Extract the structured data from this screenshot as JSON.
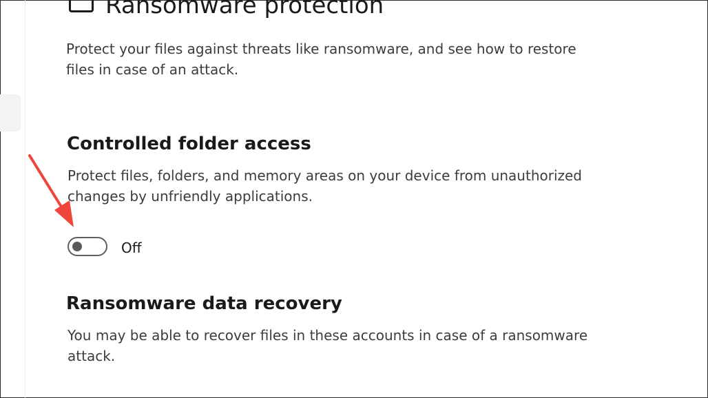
{
  "page": {
    "title": "Ransomware protection",
    "description": "Protect your files against threats like ransomware, and see how to restore files in case of an attack."
  },
  "controlled_folder_access": {
    "heading": "Controlled folder access",
    "description": "Protect files, folders, and memory areas on your device from unauthorized changes by unfriendly applications.",
    "toggle": {
      "state": "off",
      "label": "Off"
    }
  },
  "data_recovery": {
    "heading": "Ransomware data recovery",
    "description": "You may be able to recover files in these accounts in case of a ransomware attack."
  },
  "annotation": {
    "arrow_color": "#f0453a"
  },
  "colors": {
    "toggle_border": "#5e5e5e",
    "knob": "#5a5a5a",
    "text_primary": "#1a1a1a",
    "text_secondary": "#3c3c3c"
  }
}
